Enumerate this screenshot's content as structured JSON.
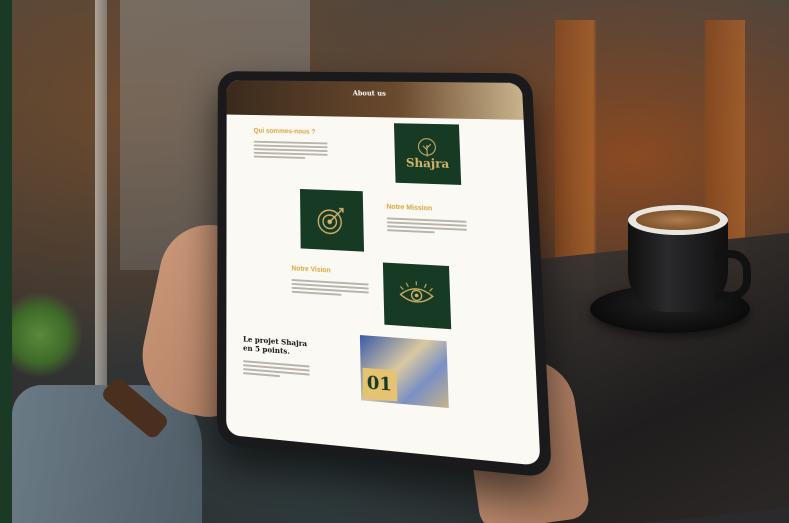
{
  "photo": {
    "scene": [
      "background-photo",
      "coffee-cup",
      "hands-holding-tablet"
    ]
  },
  "tablet_page": {
    "hero": {
      "title": "About us",
      "subtitle": ""
    },
    "section_who": {
      "heading": "Qui sommes-nous ?"
    },
    "brand": {
      "name": "Shajra",
      "tagline": ""
    },
    "section_mission": {
      "heading": "Notre Mission"
    },
    "section_vision": {
      "heading": "Notre Vision"
    },
    "project": {
      "title": "Le projet Shajra en 5 points.",
      "number": "01"
    }
  },
  "colors": {
    "brand_green": "#173a24",
    "accent_gold": "#d7a63c"
  },
  "icons": [
    "tree-icon",
    "target-icon",
    "eye-icon"
  ]
}
